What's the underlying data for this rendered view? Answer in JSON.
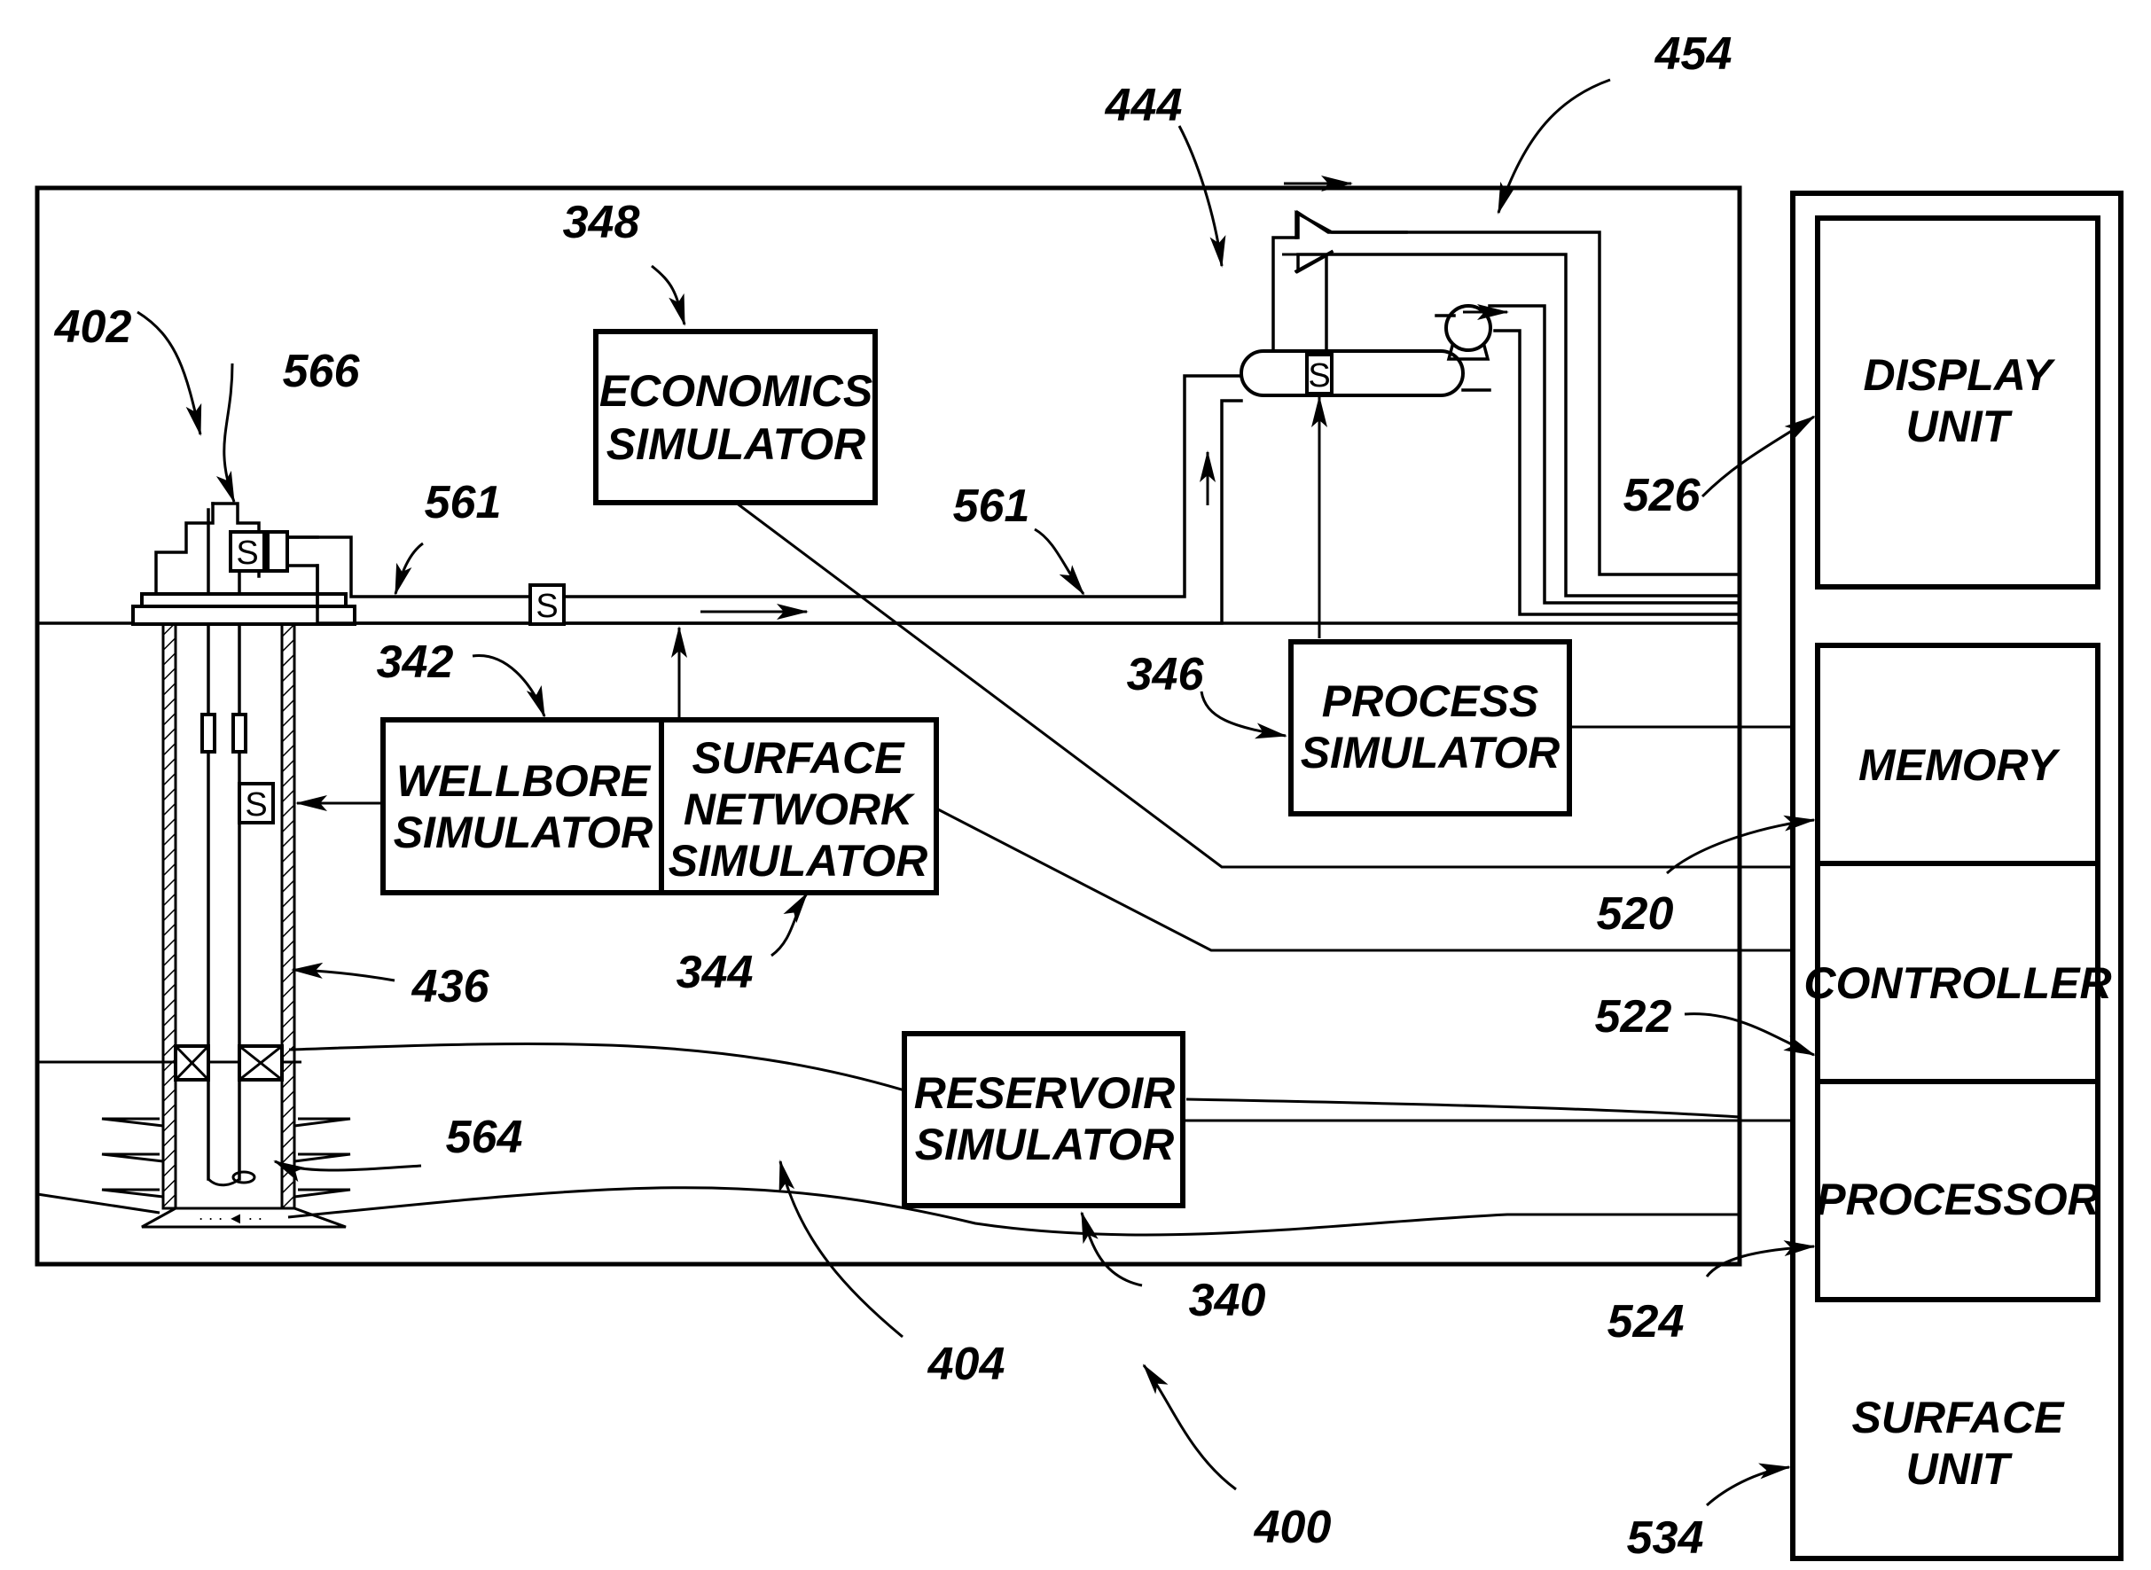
{
  "figure": {
    "colors": {
      "ink": "#000000",
      "background": "#ffffff"
    },
    "blocks": {
      "economics": {
        "line1": "ECONOMICS",
        "line2": "SIMULATOR"
      },
      "wellbore": {
        "line1": "WELLBORE",
        "line2": "SIMULATOR"
      },
      "surface_network": {
        "line1": "SURFACE",
        "line2": "NETWORK",
        "line3": "SIMULATOR"
      },
      "process": {
        "line1": "PROCESS",
        "line2": "SIMULATOR"
      },
      "reservoir": {
        "line1": "RESERVOIR",
        "line2": "SIMULATOR"
      },
      "display_unit": {
        "line1": "DISPLAY",
        "line2": "UNIT"
      },
      "memory": {
        "line1": "MEMORY"
      },
      "controller": {
        "line1": "CONTROLLER"
      },
      "processor": {
        "line1": "PROCESSOR"
      },
      "surface_unit": {
        "line1": "SURFACE",
        "line2": "UNIT"
      }
    },
    "sensor_label": "S",
    "reference_numerals": {
      "r454": "454",
      "r444": "444",
      "r348": "348",
      "r402": "402",
      "r566": "566",
      "r561a": "561",
      "r561b": "561",
      "r526": "526",
      "r342": "342",
      "r346": "346",
      "r520": "520",
      "r344": "344",
      "r436": "436",
      "r522": "522",
      "r564": "564",
      "r340": "340",
      "r524": "524",
      "r404": "404",
      "r400": "400",
      "r534": "534"
    }
  }
}
